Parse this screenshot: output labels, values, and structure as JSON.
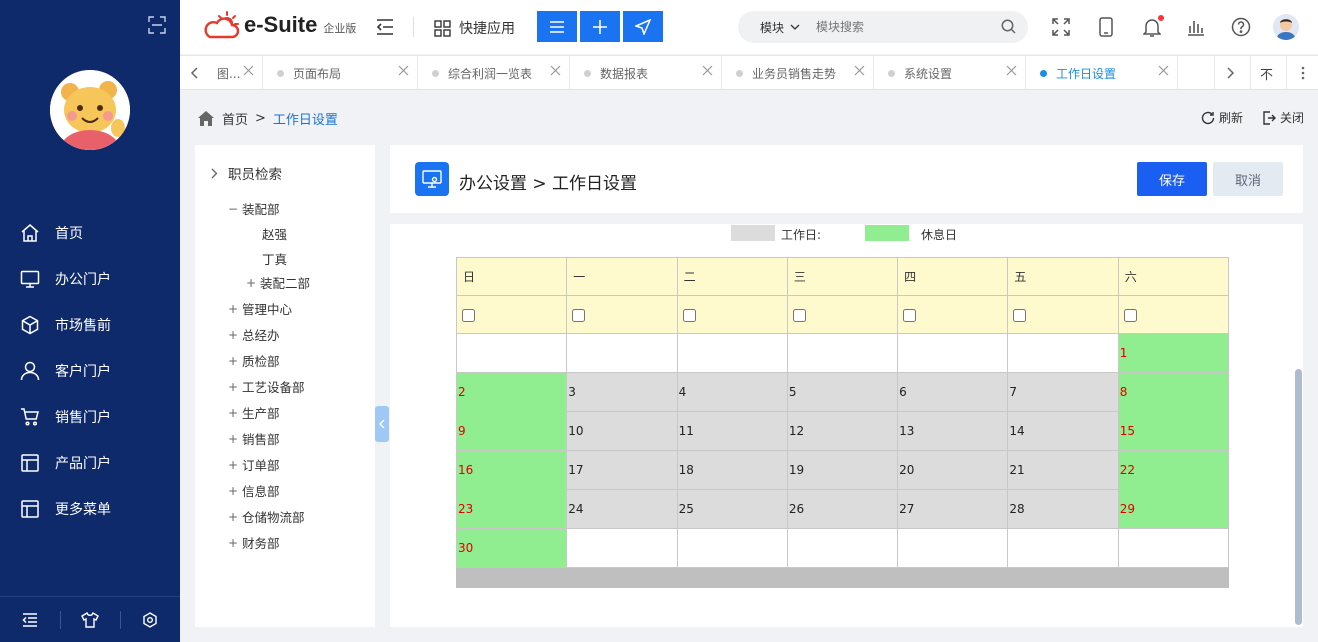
{
  "app": {
    "name": "e-Suite",
    "edition": "企业版"
  },
  "header": {
    "quick_apps_label": "快捷应用",
    "search": {
      "module_label": "模块",
      "placeholder": "模块搜索"
    }
  },
  "sidebar": {
    "items": [
      {
        "label": "首页",
        "icon": "home-icon"
      },
      {
        "label": "办公门户",
        "icon": "monitor-icon"
      },
      {
        "label": "市场售前",
        "icon": "cube-icon"
      },
      {
        "label": "客户门户",
        "icon": "user-icon"
      },
      {
        "label": "销售门户",
        "icon": "cart-icon"
      },
      {
        "label": "产品门户",
        "icon": "layout-icon"
      },
      {
        "label": "更多菜单",
        "icon": "layout-icon"
      }
    ]
  },
  "tabs": [
    {
      "label": "图...",
      "active": false
    },
    {
      "label": "页面布局",
      "active": false
    },
    {
      "label": "综合利润一览表",
      "active": false
    },
    {
      "label": "数据报表",
      "active": false
    },
    {
      "label": "业务员销售走势",
      "active": false
    },
    {
      "label": "系统设置",
      "active": false
    },
    {
      "label": "工作日设置",
      "active": true
    }
  ],
  "tab_controls": {
    "extra_label": "不"
  },
  "breadcrumb": {
    "home": "首页",
    "sep": ">",
    "current": "工作日设置"
  },
  "page_actions": {
    "refresh": "刷新",
    "close": "关闭"
  },
  "tree": {
    "root": "职员检索",
    "nodes": [
      {
        "label": "装配部",
        "toggle": "−"
      },
      {
        "label": "赵强",
        "toggle": ""
      },
      {
        "label": "丁真",
        "toggle": ""
      },
      {
        "label": "装配二部",
        "toggle": "+"
      },
      {
        "label": "管理中心",
        "toggle": "+"
      },
      {
        "label": "总经办",
        "toggle": "+"
      },
      {
        "label": "质检部",
        "toggle": "+"
      },
      {
        "label": "工艺设备部",
        "toggle": "+"
      },
      {
        "label": "生产部",
        "toggle": "+"
      },
      {
        "label": "销售部",
        "toggle": "+"
      },
      {
        "label": "订单部",
        "toggle": "+"
      },
      {
        "label": "信息部",
        "toggle": "+"
      },
      {
        "label": "仓储物流部",
        "toggle": "+"
      },
      {
        "label": "财务部",
        "toggle": "+"
      }
    ]
  },
  "content": {
    "title": "办公设置 > 工作日设置",
    "save_label": "保存",
    "cancel_label": "取消"
  },
  "legend": {
    "workday": "工作日:",
    "restday": "休息日",
    "workday_color": "#dcdcdc",
    "restday_color": "#90ee90"
  },
  "calendar": {
    "weekdays": [
      "日",
      "一",
      "二",
      "三",
      "四",
      "五",
      "六"
    ],
    "weeks": [
      [
        {
          "day": "",
          "type": "empty"
        },
        {
          "day": "",
          "type": "empty"
        },
        {
          "day": "",
          "type": "empty"
        },
        {
          "day": "",
          "type": "empty"
        },
        {
          "day": "",
          "type": "empty"
        },
        {
          "day": "",
          "type": "empty"
        },
        {
          "day": "1",
          "type": "rest"
        }
      ],
      [
        {
          "day": "2",
          "type": "rest"
        },
        {
          "day": "3",
          "type": "work"
        },
        {
          "day": "4",
          "type": "work"
        },
        {
          "day": "5",
          "type": "work"
        },
        {
          "day": "6",
          "type": "work"
        },
        {
          "day": "7",
          "type": "work"
        },
        {
          "day": "8",
          "type": "rest"
        }
      ],
      [
        {
          "day": "9",
          "type": "rest"
        },
        {
          "day": "10",
          "type": "work"
        },
        {
          "day": "11",
          "type": "work"
        },
        {
          "day": "12",
          "type": "work"
        },
        {
          "day": "13",
          "type": "work"
        },
        {
          "day": "14",
          "type": "work"
        },
        {
          "day": "15",
          "type": "rest"
        }
      ],
      [
        {
          "day": "16",
          "type": "rest"
        },
        {
          "day": "17",
          "type": "work"
        },
        {
          "day": "18",
          "type": "work"
        },
        {
          "day": "19",
          "type": "work"
        },
        {
          "day": "20",
          "type": "work"
        },
        {
          "day": "21",
          "type": "work"
        },
        {
          "day": "22",
          "type": "rest"
        }
      ],
      [
        {
          "day": "23",
          "type": "rest"
        },
        {
          "day": "24",
          "type": "work"
        },
        {
          "day": "25",
          "type": "work"
        },
        {
          "day": "26",
          "type": "work"
        },
        {
          "day": "27",
          "type": "work"
        },
        {
          "day": "28",
          "type": "work"
        },
        {
          "day": "29",
          "type": "rest"
        }
      ],
      [
        {
          "day": "30",
          "type": "rest"
        },
        {
          "day": "",
          "type": "empty"
        },
        {
          "day": "",
          "type": "empty"
        },
        {
          "day": "",
          "type": "empty"
        },
        {
          "day": "",
          "type": "empty"
        },
        {
          "day": "",
          "type": "empty"
        },
        {
          "day": "",
          "type": "empty"
        }
      ]
    ]
  }
}
